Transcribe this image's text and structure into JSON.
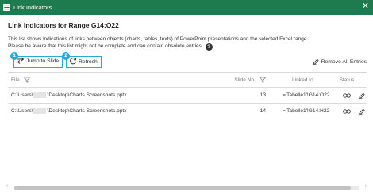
{
  "window": {
    "title": "Link Indicators",
    "close_glyph": "✕"
  },
  "heading": "Link Indicators for Range G14:O22",
  "description": {
    "line1": "This list shows indications of links between objects (charts, tables, texts) of PowerPoint presentations and the selected Excel range.",
    "line2": "Please be aware that this list might not be complete and can contain obsolete entries.",
    "help_glyph": "?"
  },
  "toolbar": {
    "jump_label": "Jump to Slide",
    "jump_badge": "1",
    "refresh_label": "Refresh",
    "refresh_badge": "2",
    "remove_all_label": "Remove All Entries"
  },
  "table": {
    "columns": {
      "file": "File",
      "slide": "Slide No.",
      "linked": "Linked to",
      "status": "Status"
    },
    "rows": [
      {
        "file_prefix": "C:\\Users\\",
        "file_suffix": "\\Desktop\\Charts Screenshots.pptx",
        "slide": "13",
        "linked": "='Tabelle1'!G14:O22",
        "status_icon": "link-icon"
      },
      {
        "file_prefix": "C:\\Users\\",
        "file_suffix": "\\Desktop\\Charts Screenshots.pptx",
        "slide": "14",
        "linked": "='Tabelle1'!G14:H22",
        "status_icon": "link-icon"
      }
    ]
  },
  "colors": {
    "titlebar": "#1e7a4f",
    "accent": "#25a9e1"
  },
  "icons": [
    "excel-app-icon",
    "close-icon",
    "help-icon",
    "jump-arrows-icon",
    "refresh-icon",
    "eraser-icon",
    "filter-icon",
    "link-icon"
  ]
}
